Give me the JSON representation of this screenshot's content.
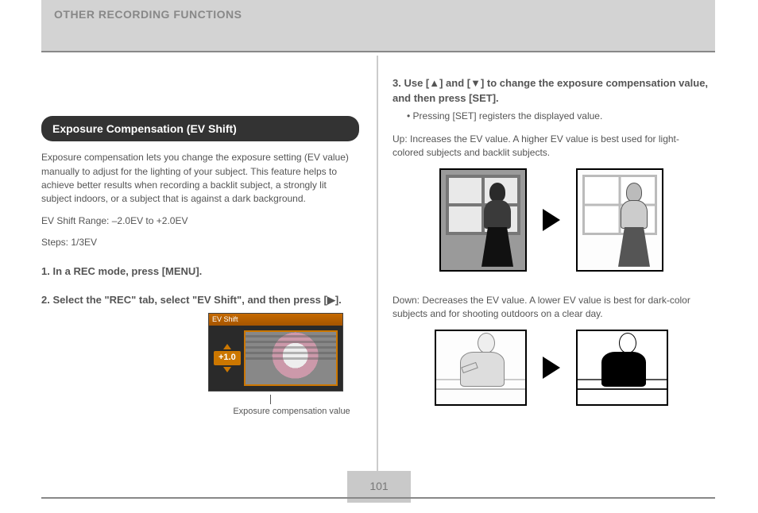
{
  "header": {
    "section_title": "OTHER RECORDING FUNCTIONS"
  },
  "left": {
    "section_heading": "Exposure Compensation (EV Shift)",
    "intro": "Exposure compensation lets you change the exposure setting (EV value) manually to adjust for the lighting of your subject. This feature helps to achieve better results when recording a backlit subject, a strongly lit subject indoors, or a subject that is against a dark background.",
    "range_line": "EV Shift Range: –2.0EV to +2.0EV",
    "steps_line": "Steps: 1/3EV",
    "step1_head": "1. In a REC mode, press [MENU].",
    "step2_head": "2. Select the \"REC\" tab, select \"EV Shift\", and then press [▶].",
    "lcd": {
      "title": "EV Shift",
      "value": "+1.0",
      "caption": "Exposure compensation value"
    }
  },
  "right": {
    "step3_head": "3. Use [▲] and [▼] to change the exposure compensation value, and then press [SET].",
    "step3_note": "• Pressing [SET] registers the displayed value.",
    "plus_label": "Up: Increases the EV value. A higher EV value is best used for light-colored subjects and backlit subjects.",
    "minus_label": "Down: Decreases the EV value. A lower EV value is best for dark-color subjects and for shooting outdoors on a clear day."
  },
  "footer": {
    "page_number": "101"
  }
}
